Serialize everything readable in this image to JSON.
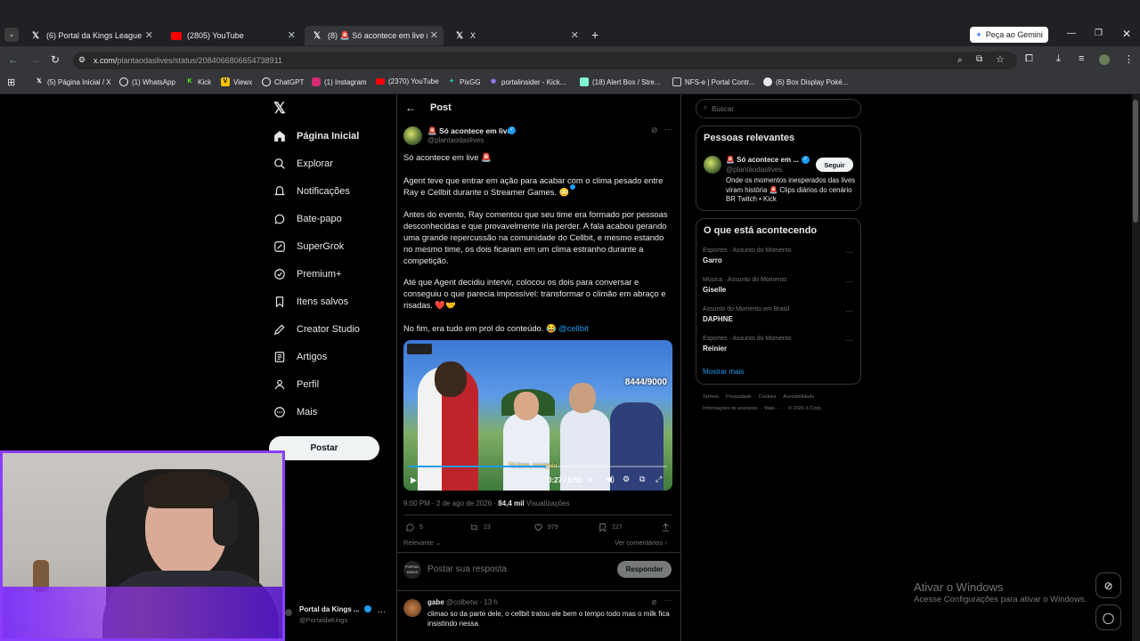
{
  "browser": {
    "tabs": [
      {
        "title": "(6) Portal da Kings League 👑 n",
        "icon": "x-logo"
      },
      {
        "title": "(2805) YouTube",
        "icon": "youtube-logo"
      },
      {
        "title": "(8) 🚨 Só acontece em live no",
        "icon": "x-logo"
      },
      {
        "title": "X",
        "icon": "x-logo"
      }
    ],
    "gemini_button": "Peça ao Gemini",
    "url_prefix": "x.com/",
    "url_rest": "plantaodaslives/status/2084066806654738911",
    "bookmarks": [
      {
        "label": "(5) Página Inicial / X",
        "icon": "x"
      },
      {
        "label": "(1) WhatsApp",
        "icon": "whatsapp"
      },
      {
        "label": "Kick",
        "icon": "kick"
      },
      {
        "label": "Viewx",
        "icon": "viewx"
      },
      {
        "label": "ChatGPT",
        "icon": "chatgpt"
      },
      {
        "label": "(1) Instagram",
        "icon": "instagram"
      },
      {
        "label": "(2370) YouTube",
        "icon": "youtube"
      },
      {
        "label": "PixGG",
        "icon": "pixgg"
      },
      {
        "label": "portalinsider - Kick...",
        "icon": "kick"
      },
      {
        "label": "(18) Alert Box / Stre...",
        "icon": "streamlabs"
      },
      {
        "label": "NFS-e | Portal Contr...",
        "icon": "doc"
      },
      {
        "label": "(6) Box Display Poké...",
        "icon": "pokeball"
      }
    ]
  },
  "sidebar": {
    "items": [
      {
        "label": "Página Inicial",
        "icon": "home-icon"
      },
      {
        "label": "Explorar",
        "icon": "search-icon"
      },
      {
        "label": "Notificações",
        "icon": "bell-icon"
      },
      {
        "label": "Bate-papo",
        "icon": "chat-icon"
      },
      {
        "label": "SuperGrok",
        "icon": "grok-icon"
      },
      {
        "label": "Premium+",
        "icon": "premium-icon"
      },
      {
        "label": "Itens salvos",
        "icon": "bookmark-icon"
      },
      {
        "label": "Creator Studio",
        "icon": "creator-icon"
      },
      {
        "label": "Artigos",
        "icon": "articles-icon"
      },
      {
        "label": "Perfil",
        "icon": "profile-icon"
      },
      {
        "label": "Mais",
        "icon": "more-icon"
      }
    ],
    "post_button": "Postar",
    "account_name": "Portal da Kings ...",
    "account_handle": "@PortaldaKings"
  },
  "post": {
    "header": "Post",
    "author_name": "🚨 Só acontece em live",
    "author_handle": "@plantaodaslives",
    "paragraphs": [
      "Só acontece em live 🚨",
      "Agent teve que entrar em ação para acabar com o clima pesado entre Ray e Cellbit durante o Streamer Games. 😳",
      "Antes do evento, Ray comentou que seu time era formado por pessoas desconhecidas e que provavelmente iria perder. A fala acabou gerando uma grande repercussão na comunidade do Cellbit, e mesmo estando no mesmo time, os dois ficaram em um clima estranho durante a competição.",
      "Até que Agent decidiu intervir, colocou os dois para conversar e conseguiu o que parecia impossível: transformar o climão em abraço e risadas. ❤️🤝"
    ],
    "last_line": "No fim, era tudo em prol do conteúdo. 😂 ",
    "mention": "@cellbit",
    "video": {
      "time": "0:27 / 0:51",
      "counter": "8444/9000",
      "caption": "Tá bem, tranquilo",
      "progress": 0.53
    },
    "timestamp": "9:00 PM · 2 de ago de 2026 · ",
    "views_num": "84,4 mil",
    "views_label": " Visualizações",
    "stats": {
      "replies": "5",
      "reposts": "23",
      "likes": "979",
      "bookmarks": "227"
    },
    "relevant_label": "Relevante",
    "see_comments": "Ver comentários",
    "reply_placeholder": "Postar sua resposta",
    "reply_button": "Responder",
    "reply_avatar_text": "PORTAL KINGS",
    "comment": {
      "name": "gabe",
      "handle": "@colbetw",
      "time": "· 13 h",
      "text": "climao so da parte dele, o cellbit tratou ele bem o tempo todo mas o milk fica insistindo nessa"
    }
  },
  "right": {
    "search_placeholder": "Buscar",
    "relevant_title": "Pessoas relevantes",
    "relevant_name": "🚨 Só acontece em ...",
    "relevant_handle": "@plantaodaslives",
    "follow_button": "Seguir",
    "relevant_bio": "Onde os momentos inesperados das lives viram história 🚨 Clips diários do cenário BR Twitch • Kick",
    "trending_title": "O que está acontecendo",
    "trends": [
      {
        "category": "Esportes · Assunto do Momento",
        "name": "Garro"
      },
      {
        "category": "Música · Assunto do Momento",
        "name": "Giselle"
      },
      {
        "category": "Assunto do Momento em Brasil",
        "name": "DAPHNE"
      },
      {
        "category": "Esportes · Assunto do Momento",
        "name": "Reinier"
      }
    ],
    "show_more": "Mostrar mais",
    "footer_line1": "Termos  ·  Privacidade  ·  Cookies  ·  Acessibilidade  ·",
    "footer_line2": "Informações de anúncios  ·  Mais ···  ·  © 2026 X Corp."
  },
  "windows": {
    "line1": "Ativar o Windows",
    "line2": "Acesse Configurações para ativar o Windows."
  },
  "colors": {
    "accent": "#1d9bf0",
    "bg": "#000000",
    "border": "#2f3336",
    "overlay_purple": "#7b2cff"
  }
}
